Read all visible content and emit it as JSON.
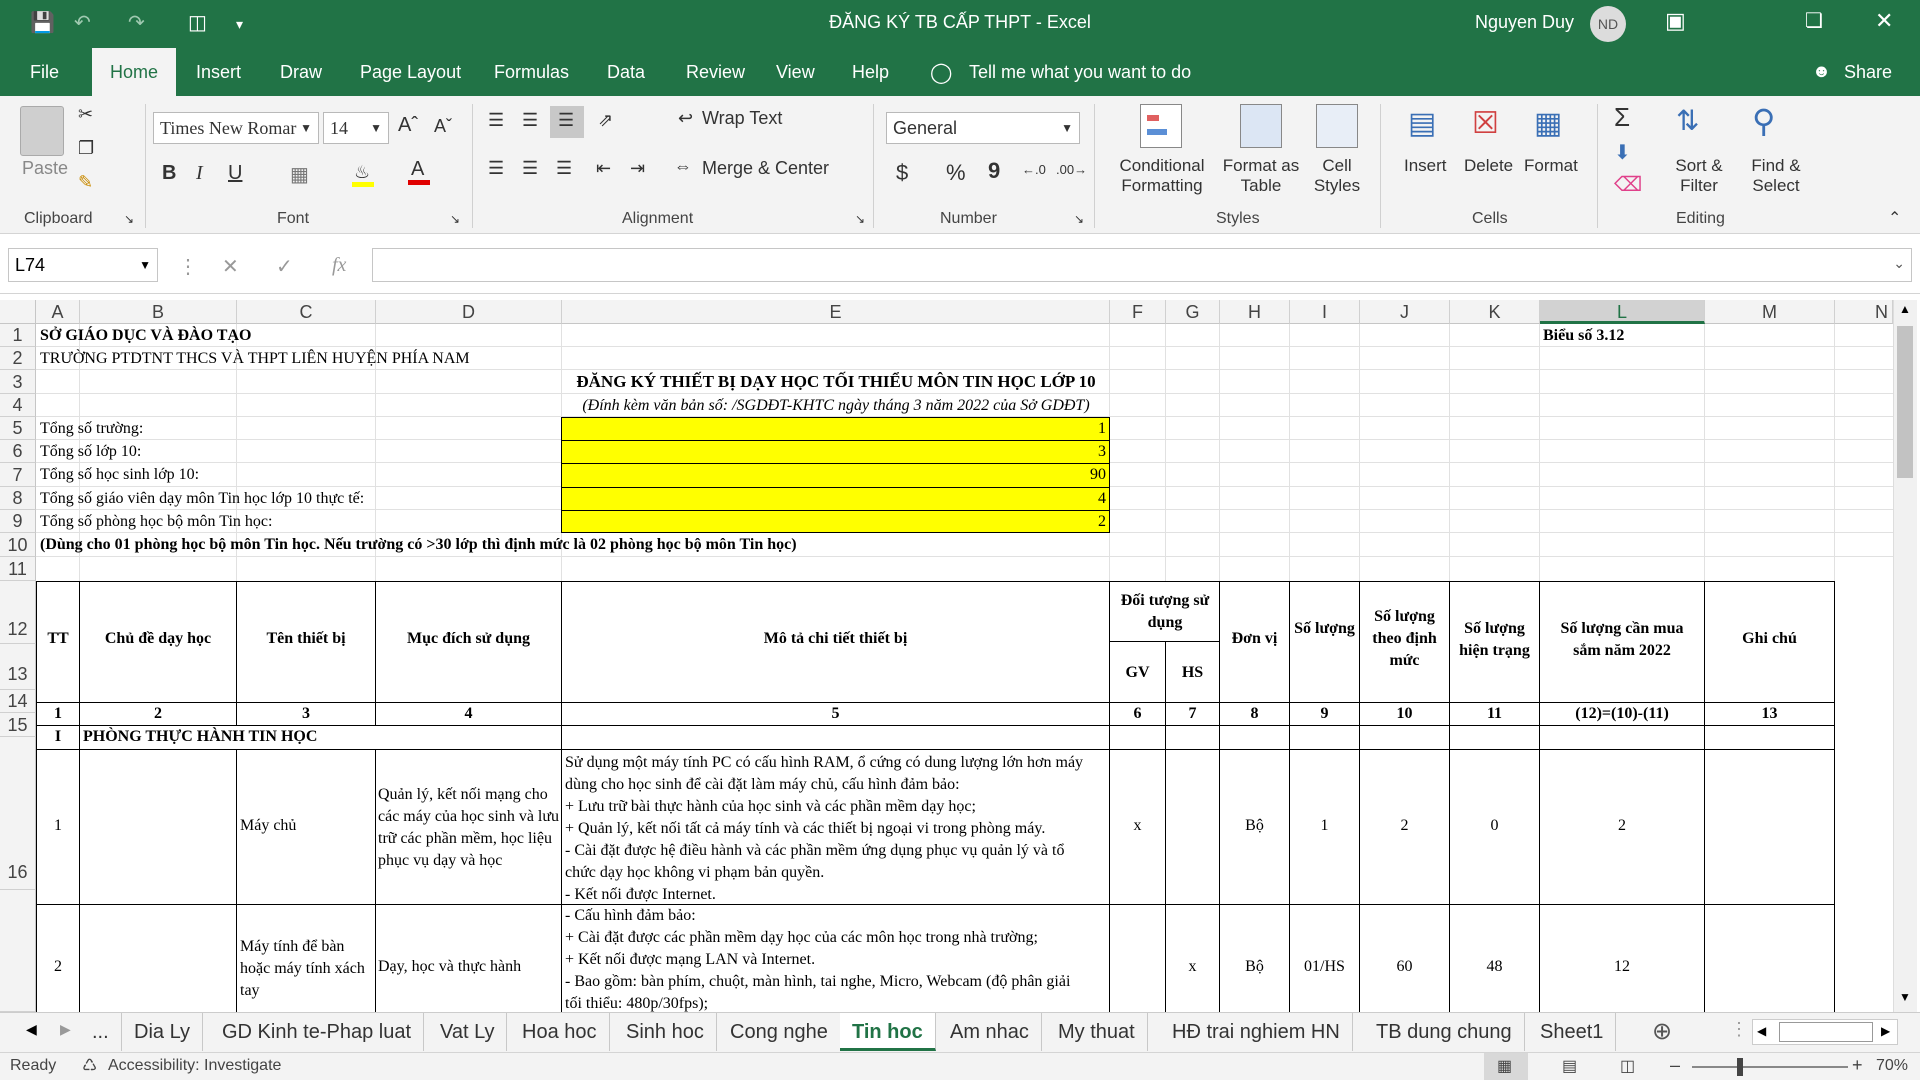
{
  "titlebar": {
    "title": "ĐĂNG KÝ TB CẤP THPT  -  Excel",
    "user": "Nguyen Duy",
    "avatar": "ND"
  },
  "tabs": [
    "File",
    "Home",
    "Insert",
    "Draw",
    "Page Layout",
    "Formulas",
    "Data",
    "Review",
    "View",
    "Help"
  ],
  "tell_me": "Tell me what you want to do",
  "share": "Share",
  "ribbon": {
    "clipboard": {
      "label": "Clipboard",
      "paste": "Paste"
    },
    "font": {
      "label": "Font",
      "name": "Times New Romar",
      "size": "14",
      "bold": "B",
      "italic": "I",
      "underline": "U"
    },
    "alignment": {
      "label": "Alignment",
      "wrap": "Wrap Text",
      "merge": "Merge & Center"
    },
    "number": {
      "label": "Number",
      "format": "General",
      "currency": "$",
      "percent": "%",
      "comma": "9"
    },
    "styles": {
      "label": "Styles",
      "conditional": "Conditional",
      "conditional2": "Formatting",
      "format_as": "Format as",
      "format_as2": "Table",
      "cell": "Cell",
      "cell2": "Styles"
    },
    "cells": {
      "label": "Cells",
      "insert": "Insert",
      "delete": "Delete",
      "format": "Format"
    },
    "editing": {
      "label": "Editing",
      "sort": "Sort &",
      "sort2": "Filter",
      "find": "Find &",
      "find2": "Select"
    }
  },
  "formula_bar": {
    "namebox": "L74",
    "fx": "fx",
    "content": ""
  },
  "columns": [
    "A",
    "B",
    "C",
    "D",
    "E",
    "F",
    "G",
    "H",
    "I",
    "J",
    "K",
    "L",
    "M",
    "N"
  ],
  "rows": [
    "1",
    "2",
    "3",
    "4",
    "5",
    "6",
    "7",
    "8",
    "9",
    "10",
    "11",
    "12",
    "13",
    "14",
    "15",
    "16"
  ],
  "sheet": {
    "r1a": "SỞ GIÁO DỤC VÀ ĐÀO TẠO",
    "r1l": "Biểu số 3.12",
    "r2a": "TRƯỜNG PTDTNT THCS VÀ THPT LIÊN HUYỆN PHÍA NAM",
    "r3": "ĐĂNG KÝ THIẾT BỊ DẠY HỌC TỐI THIỂU MÔN TIN HỌC LỚP 10",
    "r4": "(Đính kèm văn bản số:                     /SGDĐT-KHTC ngày        tháng 3 năm 2022 của Sở GDĐT)",
    "r5": "Tổng số trường:",
    "r5v": "1",
    "r6": "Tổng số lớp 10:",
    "r6v": "3",
    "r7": "Tổng số học sinh lớp 10:",
    "r7v": "90",
    "r8": "Tổng số giáo viên dạy môn Tin học lớp 10 thực tế:",
    "r8v": "4",
    "r9": "Tổng số phòng học bộ môn Tin học:",
    "r9v": "2",
    "r10": "(Dùng cho 01 phòng học bộ môn Tin học. Nếu trường có >30 lớp thì định mức là 02 phòng học bộ môn Tin học)",
    "headers": {
      "tt": "TT",
      "chude": "Chủ đề dạy học",
      "tentb": "Tên thiết bị",
      "mucdich": "Mục đích sử dụng",
      "mota": "Mô tả chi tiết thiết bị",
      "doituong": "Đối tượng sử dụng",
      "gv": "GV",
      "hs": "HS",
      "donvi": "Đơn vị",
      "soluong": "Số lượng",
      "dinhmuc": "Số lượng theo định mức",
      "hientrang": "Số lượng hiện trạng",
      "canmua": "Số lượng cần mua sắm năm 2022",
      "ghichu": "Ghi chú"
    },
    "nums": [
      "1",
      "2",
      "3",
      "4",
      "5",
      "6",
      "7",
      "8",
      "9",
      "10",
      "11",
      "(12)=(10)-(11)",
      "13"
    ],
    "r15a": "I",
    "r15b": "PHÒNG THỰC HÀNH TIN HỌC",
    "item1": {
      "tt": "1",
      "ten": "Máy chủ",
      "mucdich": "Quản lý, kết nối mạng cho các máy của học sinh và lưu trữ các phần mềm, học liệu phục vụ dạy và học",
      "mota": [
        "Sử dụng một máy tính PC có cấu hình RAM, ổ cứng có dung lượng lớn hơn máy",
        "dùng cho học sinh để cài đặt làm máy chủ, cấu hình đảm bảo:",
        "+ Lưu trữ bài thực hành của học sinh và các phần mềm dạy học;",
        "+ Quản lý, kết nối tất cả máy tính và các thiết bị ngoại vi trong phòng máy.",
        "- Cài đặt được hệ điều hành và các phần mềm ứng dụng phục vụ quản lý và tổ",
        "chức dạy học không vi phạm bản quyền.",
        "- Kết nối được Internet."
      ],
      "gv": "x",
      "hs": "",
      "donvi": "Bộ",
      "soluong": "1",
      "dinhmuc": "2",
      "hientrang": "0",
      "canmua": "2"
    },
    "item2": {
      "tt": "2",
      "ten": "Máy tính để bàn hoặc máy tính xách tay",
      "mucdich": "Dạy, học và thực hành",
      "mota": [
        "- Cấu hình đảm bảo:",
        "+ Cài đặt được các phần mềm dạy học của các môn học trong nhà trường;",
        "+ Kết nối được mạng LAN và Internet.",
        "- Bao gồm: bàn phím, chuột, màn hình, tai nghe, Micro, Webcam (độ phân giải",
        "tối thiểu: 480p/30fps);"
      ],
      "gv": "",
      "hs": "x",
      "donvi": "Bộ",
      "soluong": "01/HS",
      "dinhmuc": "60",
      "hientrang": "48",
      "canmua": "12"
    }
  },
  "sheet_tabs": [
    "...",
    "Dia Ly",
    "GD Kinh te-Phap luat",
    "Vat Ly",
    "Hoa hoc",
    "Sinh hoc",
    "Cong nghe",
    "Tin hoc",
    "Am nhac",
    "My thuat",
    "HĐ trai nghiem HN",
    "TB dung chung",
    "Sheet1"
  ],
  "status": {
    "ready": "Ready",
    "accessibility": "Accessibility: Investigate",
    "zoom": "70%"
  }
}
